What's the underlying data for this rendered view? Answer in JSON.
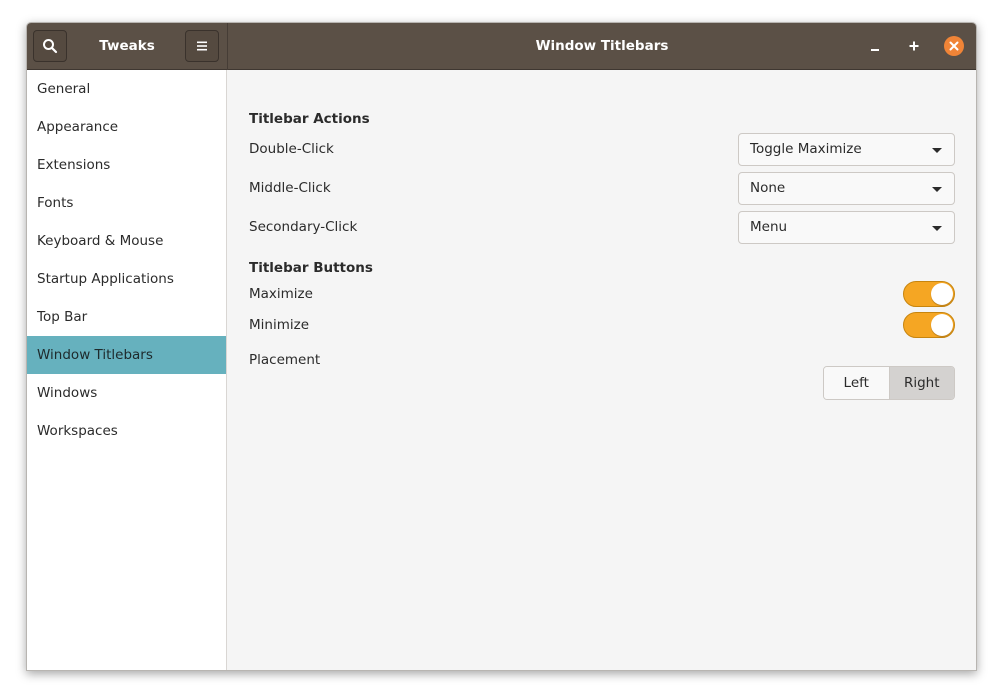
{
  "header": {
    "app_title": "Tweaks",
    "page_title": "Window Titlebars",
    "icons": {
      "search": "search-icon",
      "menu": "hamburger-menu-icon",
      "minimize": "minimize-icon",
      "maximize": "maximize-icon",
      "close": "close-icon"
    },
    "colors": {
      "headerbar": "#5b5046",
      "close_button": "#f08437"
    }
  },
  "sidebar": {
    "items": [
      {
        "label": "General"
      },
      {
        "label": "Appearance"
      },
      {
        "label": "Extensions"
      },
      {
        "label": "Fonts"
      },
      {
        "label": "Keyboard & Mouse"
      },
      {
        "label": "Startup Applications"
      },
      {
        "label": "Top Bar"
      },
      {
        "label": "Window Titlebars",
        "selected": true
      },
      {
        "label": "Windows"
      },
      {
        "label": "Workspaces"
      }
    ],
    "selected_color": "#66b1be"
  },
  "titlebar_actions": {
    "title": "Titlebar Actions",
    "double_click": {
      "label": "Double-Click",
      "value": "Toggle Maximize"
    },
    "middle_click": {
      "label": "Middle-Click",
      "value": "None"
    },
    "secondary_click": {
      "label": "Secondary-Click",
      "value": "Menu"
    }
  },
  "titlebar_buttons": {
    "title": "Titlebar Buttons",
    "maximize": {
      "label": "Maximize",
      "enabled": true
    },
    "minimize": {
      "label": "Minimize",
      "enabled": true
    },
    "placement": {
      "label": "Placement",
      "options": [
        "Left",
        "Right"
      ],
      "selected": "Right"
    },
    "toggle_color": "#f5a623"
  }
}
